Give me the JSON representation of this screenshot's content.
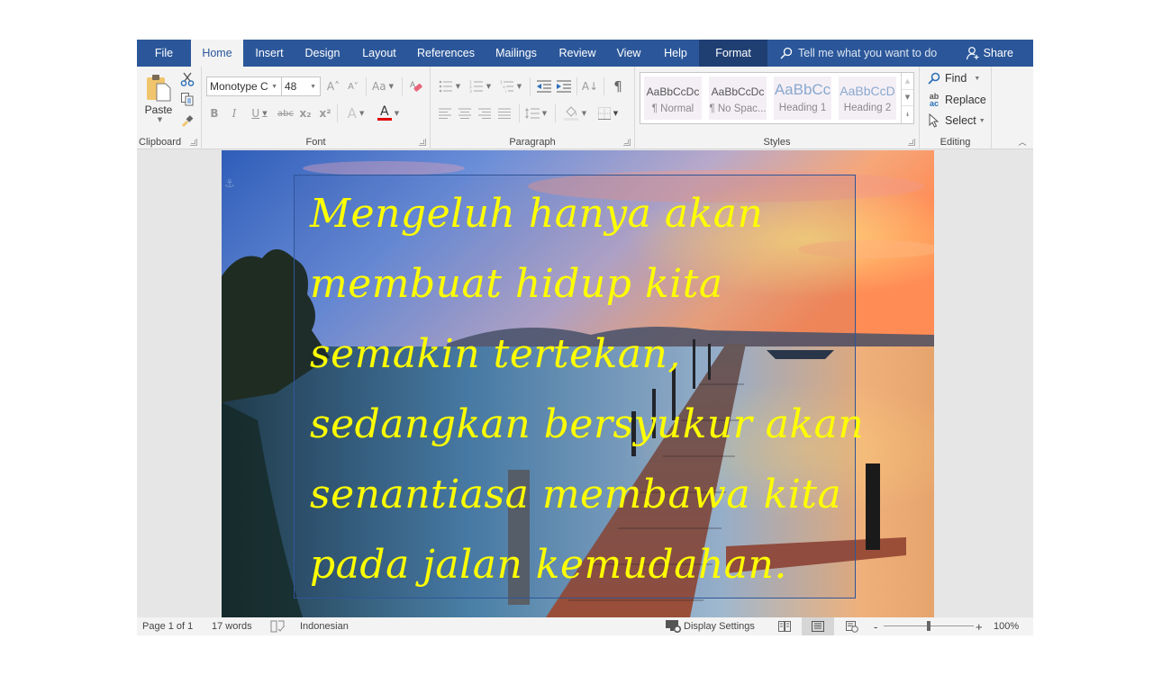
{
  "tabs": {
    "file": "File",
    "items": [
      "Home",
      "Insert",
      "Design",
      "Layout",
      "References",
      "Mailings",
      "Review",
      "View",
      "Help"
    ],
    "format": "Format",
    "active": "Home",
    "tell_me_placeholder": "Tell me what you want to do",
    "share": "Share"
  },
  "ribbon": {
    "clipboard": {
      "label": "Clipboard",
      "paste": "Paste",
      "cut_icon": "scissors-icon",
      "copy_icon": "copy-icon",
      "format_painter_icon": "paintbrush-icon"
    },
    "font": {
      "label": "Font",
      "font_name": "Monotype C",
      "font_size": "48",
      "grow": "A˄",
      "shrink": "A˅",
      "change_case": "Aa",
      "bold": "B",
      "italic": "I",
      "underline": "U",
      "strike": "abc",
      "subscript": "x₂",
      "superscript": "x²",
      "text_effects": "A",
      "font_color": "A",
      "font_color_hex": "#e00000"
    },
    "paragraph": {
      "label": "Paragraph",
      "pilcrow": "¶",
      "sort": "A↓"
    },
    "styles": {
      "label": "Styles",
      "items": [
        {
          "sample": "AaBbCcDc",
          "name": "¶ Normal"
        },
        {
          "sample": "AaBbCcDc",
          "name": "¶ No Spac..."
        },
        {
          "sample": "AaBbCc",
          "name": "Heading 1"
        },
        {
          "sample": "AaBbCcD",
          "name": "Heading 2"
        }
      ]
    },
    "editing": {
      "label": "Editing",
      "find": "Find",
      "replace": "Replace",
      "select": "Select"
    }
  },
  "document": {
    "quote_lines": [
      "Mengeluh hanya akan",
      "membuat hidup kita",
      "semakin tertekan,",
      "sedangkan bersyukur akan",
      "senantiasa membawa kita",
      "pada jalan kemudahan."
    ],
    "text_color": "#ffff00",
    "anchor_icon": "⚓"
  },
  "status": {
    "page": "Page 1 of 1",
    "words": "17 words",
    "language": "Indonesian",
    "display_settings": "Display Settings",
    "zoom_minus": "-",
    "zoom_plus": "+",
    "zoom_level": "100%",
    "zoom_fraction": 0.5
  },
  "colors": {
    "brand": "#2b579a",
    "format_tab": "#1f3f73",
    "ribbon_bg": "#f3f3f3"
  }
}
